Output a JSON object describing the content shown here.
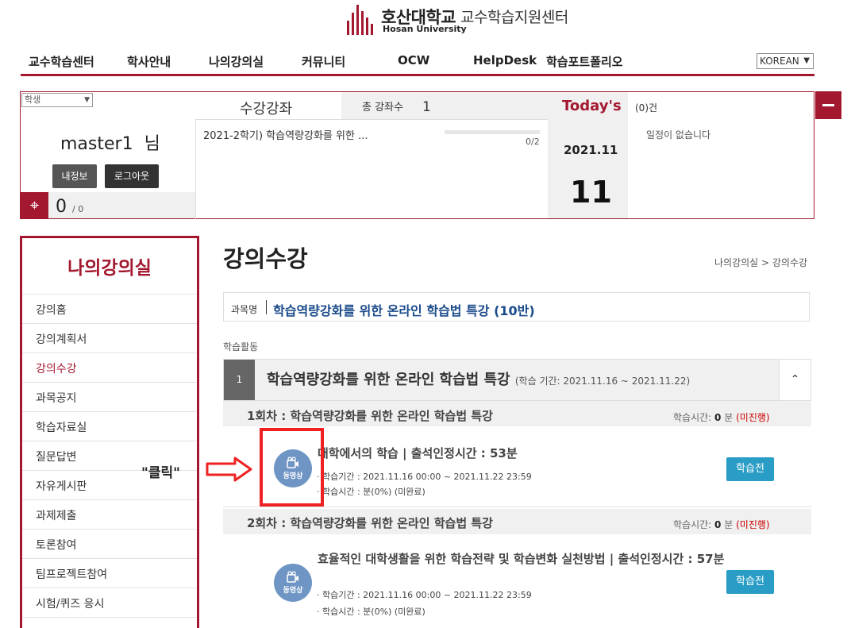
{
  "header": {
    "logo_kr": "호산대학교",
    "logo_en": "Hosan University",
    "subtitle": "교수학습지원센터"
  },
  "gnb": [
    "교수학습센터",
    "학사안내",
    "나의강의실",
    "커뮤니티",
    "OCW",
    "HelpDesk",
    "학습포트폴리오"
  ],
  "lang": {
    "value": "KOREAN"
  },
  "user": {
    "role": "학생",
    "name": "master1",
    "suffix": "님",
    "btn_info": "내정보",
    "btn_logout": "로그아웃",
    "point": "0",
    "point_total": "/ 0"
  },
  "courses": {
    "title": "수강강좌",
    "total_label": "총 강좌수",
    "total": "1",
    "items": [
      {
        "name": "2021-2학기) 학습역량강화를 위한 ...",
        "progress": "0/2",
        "progress_fraction": 0
      }
    ]
  },
  "today": {
    "label": "Today's",
    "count": "(0)건",
    "month": "2021.11",
    "day": "11",
    "empty": "일정이 없습니다"
  },
  "sidebar": {
    "title": "나의강의실",
    "items": [
      "강의홈",
      "강의계획서",
      "강의수강",
      "과목공지",
      "학습자료실",
      "질문답변",
      "자유게시판",
      "과제제출",
      "토론참여",
      "팀프로젝트참여",
      "시험/퀴즈 응시"
    ],
    "active": "강의수강"
  },
  "annotation": {
    "text": "\"클릭\""
  },
  "main": {
    "title": "강의수강",
    "breadcrumb": "나의강의실 > 강의수강",
    "subject_label": "과목명",
    "subject_name": "학습역량강화를 위한 온라인 학습법 특강 (10반)",
    "activity_label": "학습활동",
    "week": {
      "num": "1",
      "title": "학습역량강화를 위한 온라인 학습법 특강",
      "period": "(학습 기간: 2021.11.16 ~ 2021.11.22)",
      "toggle": "⌃"
    },
    "sessions": [
      {
        "title": "1회차 : 학습역량강화를 위한 온라인 학습법 특강",
        "time_label": "학습시간:",
        "time_val": "0",
        "time_unit": "분",
        "status": "(미진행)",
        "lesson": {
          "icon_label": "동영상",
          "title": "대학에서의 학습 | 출석인정시간 : 53분",
          "period": "· 학습기간 : 2021.11.16 00:00 ~ 2021.11.22 23:59",
          "time": "· 학습시간 : 분(0%) (미완료)",
          "button": "학습전"
        }
      },
      {
        "title": "2회차 : 학습역량강화를 위한 온라인 학습법 특강",
        "time_label": "학습시간:",
        "time_val": "0",
        "time_unit": "분",
        "status": "(미진행)",
        "lesson": {
          "icon_label": "동영상",
          "title": "효율적인 대학생활을 위한 학습전략 및 학습변화 실천방법 | 출석인정시간 : 57분",
          "period": "· 학습기간 : 2021.11.16 00:00 ~ 2021.11.22 23:59",
          "time": "· 학습시간 : 분(0%) (미완료)",
          "button": "학습전"
        }
      }
    ]
  },
  "colors": {
    "brand": "#a3182f",
    "study_button": "#2a9dc6",
    "video_icon": "#6f95c5",
    "status": "#cc0000"
  }
}
